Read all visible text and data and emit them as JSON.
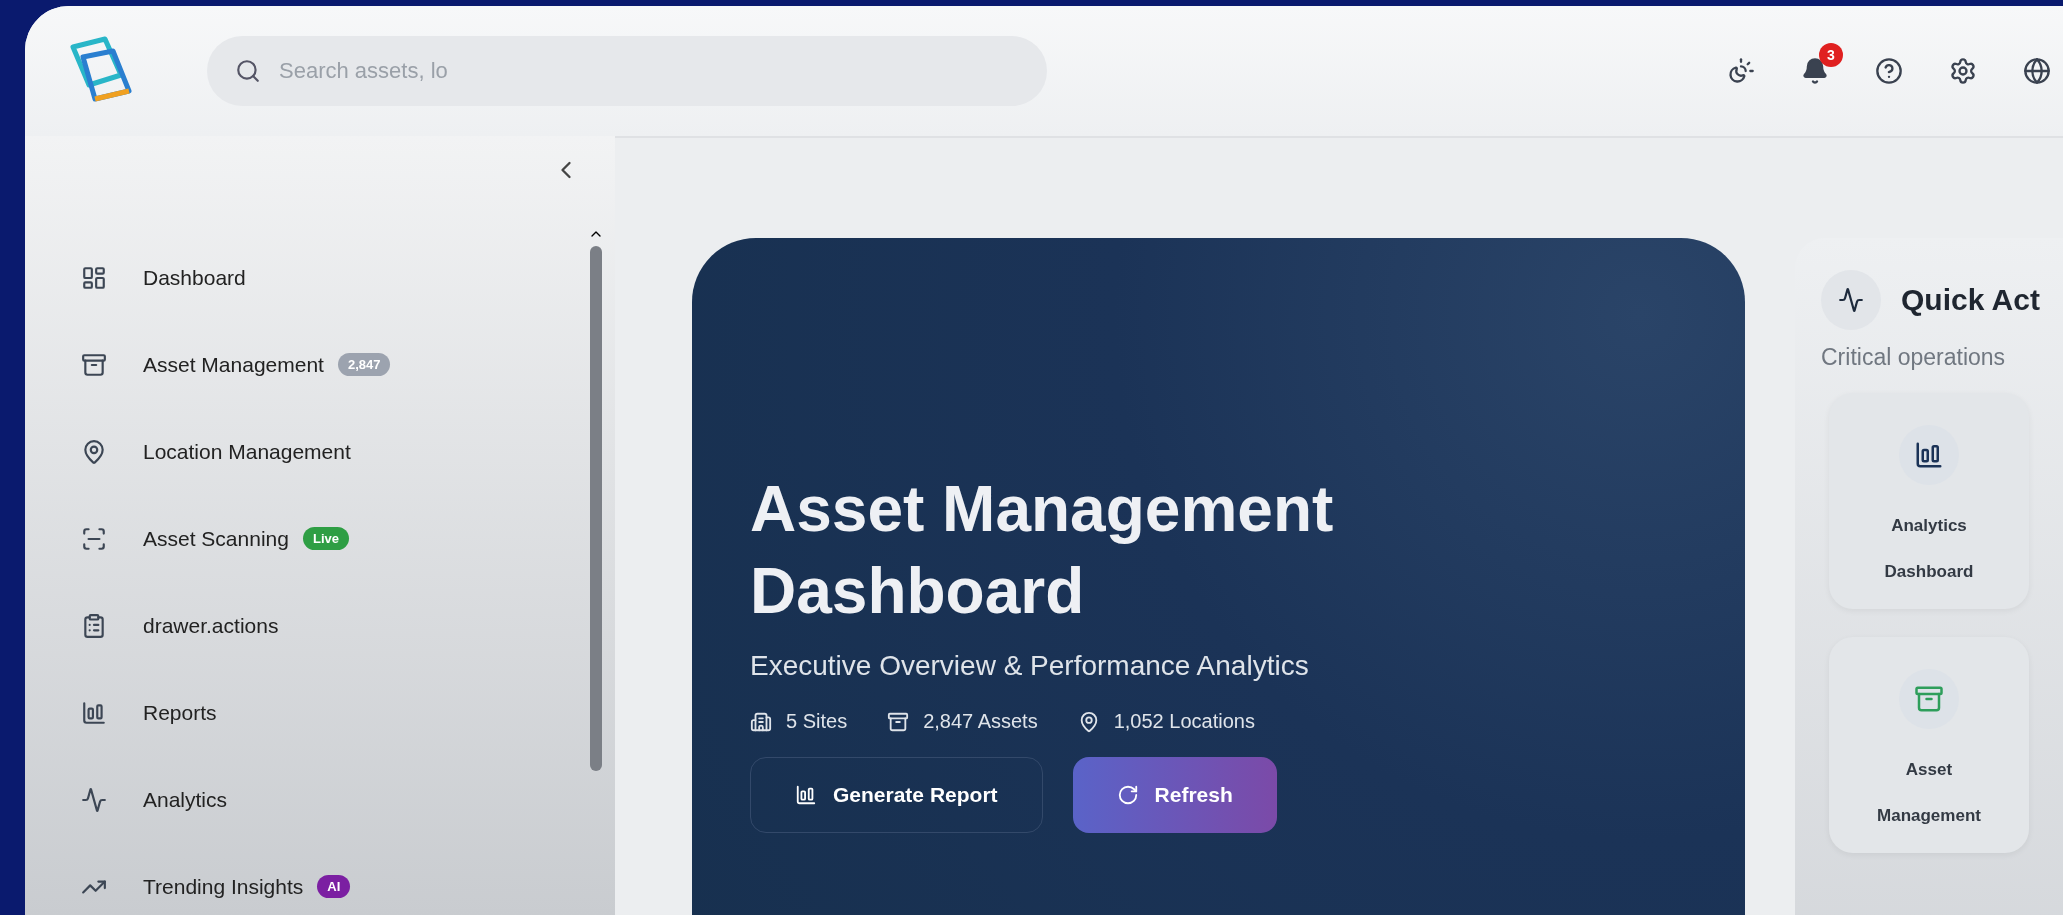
{
  "header": {
    "search": {
      "placeholder": "Search assets, lo"
    },
    "notifications": {
      "count": "3"
    }
  },
  "sidebar": {
    "items": [
      {
        "label": "Dashboard"
      },
      {
        "label": "Asset Management",
        "badge": {
          "text": "2,847",
          "color": "#9ca3af"
        }
      },
      {
        "label": "Location Management"
      },
      {
        "label": "Asset Scanning",
        "badge": {
          "text": "Live",
          "color": "#2e9e44"
        }
      },
      {
        "label": "drawer.actions"
      },
      {
        "label": "Reports"
      },
      {
        "label": "Analytics"
      },
      {
        "label": "Trending Insights",
        "badge": {
          "text": "AI",
          "color": "#7b1fa2"
        }
      }
    ]
  },
  "hero": {
    "title": "Asset Management Dashboard",
    "subtitle": "Executive Overview & Performance Analytics",
    "stats": [
      "5 Sites",
      "2,847 Assets",
      "1,052 Locations"
    ],
    "buttons": [
      {
        "label": "Generate Report",
        "kind": "outline"
      },
      {
        "label": "Refresh",
        "kind": "primary"
      }
    ]
  },
  "quick_actions": {
    "title": "Quick Act",
    "subtitle": "Critical operations",
    "tiles": [
      {
        "label": "Analytics Dashboard",
        "color": "#1b3357"
      },
      {
        "label": "Asset Management",
        "color": "#2e9e5b"
      }
    ]
  }
}
